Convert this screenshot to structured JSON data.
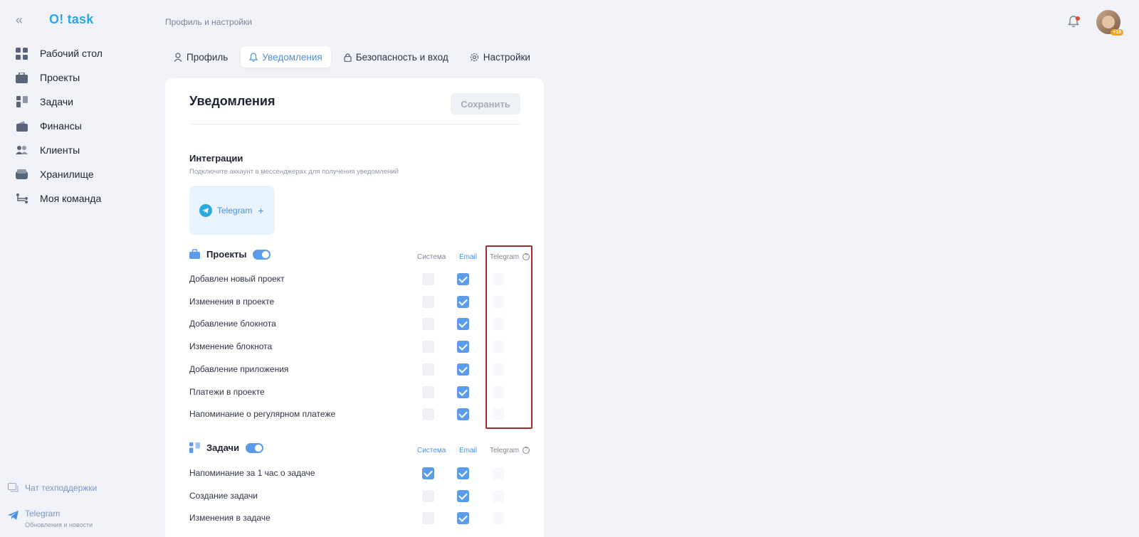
{
  "sidebar": {
    "collapse_icon": "double-chevron-left-icon",
    "logo": "O! task",
    "items": [
      {
        "label": "Рабочий стол",
        "icon": "dashboard-icon"
      },
      {
        "label": "Проекты",
        "icon": "briefcase-icon"
      },
      {
        "label": "Задачи",
        "icon": "tasks-icon"
      },
      {
        "label": "Финансы",
        "icon": "wallet-icon"
      },
      {
        "label": "Клиенты",
        "icon": "clients-icon"
      },
      {
        "label": "Хранилище",
        "icon": "storage-icon"
      },
      {
        "label": "Моя команда",
        "icon": "team-icon"
      }
    ],
    "support": "Чат техподдержки",
    "telegram": {
      "title": "Telegram",
      "subtitle": "Обновления и новости"
    }
  },
  "header": {
    "breadcrumb": "Профиль и настройки",
    "avatar_badge": "+10"
  },
  "tabs": [
    {
      "label": "Профиль",
      "icon": "user-icon",
      "active": false
    },
    {
      "label": "Уведомления",
      "icon": "bell-icon",
      "active": true
    },
    {
      "label": "Безопасность и вход",
      "icon": "lock-icon",
      "active": false
    },
    {
      "label": "Настройки",
      "icon": "gear-icon",
      "active": false
    }
  ],
  "card": {
    "title": "Уведомления",
    "save_label": "Сохранить",
    "integrations": {
      "title": "Интеграции",
      "subtitle": "Подключите аккаунт в мессенджерах для получения уведомлений",
      "telegram_label": "Telegram",
      "plus": "+"
    },
    "columns": {
      "system": "Система",
      "email": "Email",
      "telegram": "Telegram"
    },
    "sections": [
      {
        "title": "Проекты",
        "enabled": true,
        "rows": [
          {
            "label": "Добавлен новый проект",
            "system": false,
            "email": true,
            "telegram": false
          },
          {
            "label": "Изменения в проекте",
            "system": false,
            "email": true,
            "telegram": false
          },
          {
            "label": "Добавление блокнота",
            "system": false,
            "email": true,
            "telegram": false
          },
          {
            "label": "Изменение блокнота",
            "system": false,
            "email": true,
            "telegram": false
          },
          {
            "label": "Добавление приложения",
            "system": false,
            "email": true,
            "telegram": false
          },
          {
            "label": "Платежи в проекте",
            "system": false,
            "email": true,
            "telegram": false
          },
          {
            "label": "Напоминание о регулярном платеже",
            "system": false,
            "email": true,
            "telegram": false
          }
        ]
      },
      {
        "title": "Задачи",
        "enabled": true,
        "rows": [
          {
            "label": "Напоминание за 1 час о задаче",
            "system": true,
            "email": true,
            "telegram": false
          },
          {
            "label": "Создание задачи",
            "system": false,
            "email": true,
            "telegram": false
          },
          {
            "label": "Изменения в задаче",
            "system": false,
            "email": true,
            "telegram": false
          }
        ]
      }
    ]
  },
  "colors": {
    "accent": "#4a90e2",
    "logo": "#2aa8e0",
    "highlight": "#a52a2a"
  }
}
